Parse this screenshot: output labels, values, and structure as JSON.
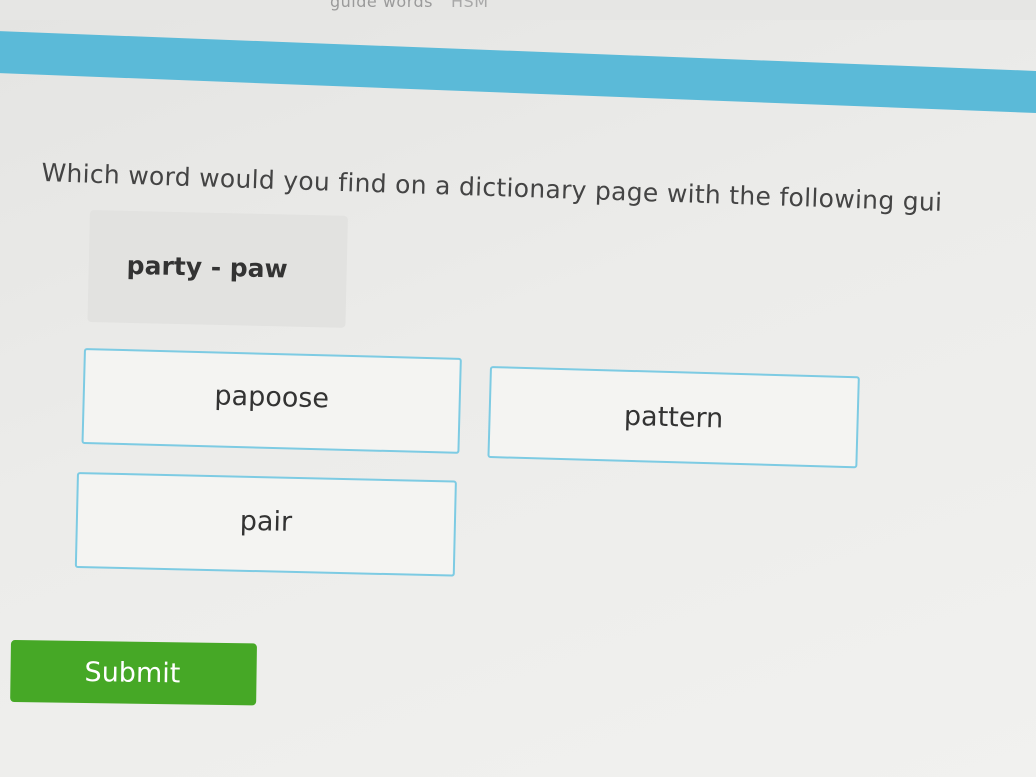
{
  "header": {
    "title_fragment": "guide words",
    "skill_code": "HSM",
    "accent_color": "#5bbad8"
  },
  "question": {
    "text": "Which word would you find on a dictionary page with the following gui"
  },
  "guide_words": {
    "text": "party - paw"
  },
  "options": [
    {
      "label": "papoose"
    },
    {
      "label": "pattern"
    },
    {
      "label": "pair"
    }
  ],
  "submit": {
    "label": "Submit",
    "color": "#46a826"
  },
  "colors": {
    "option_border": "#7dcbe3",
    "guide_box_bg": "#e2e2e0"
  }
}
